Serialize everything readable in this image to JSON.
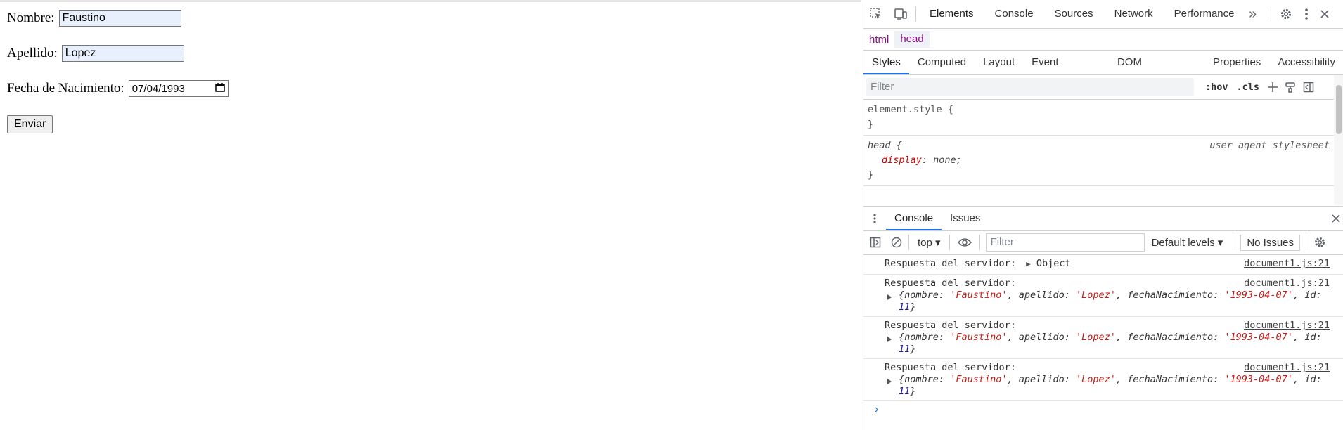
{
  "form": {
    "nombre_label": "Nombre:",
    "nombre_value": "Faustino",
    "apellido_label": "Apellido:",
    "apellido_value": "Lopez",
    "fecha_label": "Fecha de Nacimiento:",
    "fecha_value": "07/04/1993",
    "submit_label": "Enviar"
  },
  "devtools": {
    "top_tabs": [
      "Elements",
      "Console",
      "Sources",
      "Network",
      "Performance"
    ],
    "more_tabs": "»",
    "breadcrumbs": [
      "html",
      "head"
    ],
    "styles_tabs": [
      "Styles",
      "Computed",
      "Layout",
      "Event Listeners",
      "DOM Breakpoints",
      "Properties",
      "Accessibility"
    ],
    "styles_filter_placeholder": "Filter",
    "hov": ":hov",
    "cls": ".cls",
    "element_style": "element.style {",
    "close_brace": "}",
    "head_selector": "head {",
    "ua_source": "user agent stylesheet",
    "prop_name": "display",
    "prop_value": "none;",
    "drawer_tabs": [
      "Console",
      "Issues"
    ],
    "context": "top",
    "console_filter_placeholder": "Filter",
    "levels": "Default levels",
    "no_issues": "No Issues",
    "logs": [
      {
        "message": "Respuesta del servidor:",
        "source": "document1.js:21",
        "summary": "Object"
      },
      {
        "message": "Respuesta del servidor:",
        "source": "document1.js:21",
        "nombre": "'Faustino'",
        "apellido": "'Lopez'",
        "fecha": "'1993-04-07'",
        "id": "11"
      },
      {
        "message": "Respuesta del servidor:",
        "source": "document1.js:21",
        "nombre": "'Faustino'",
        "apellido": "'Lopez'",
        "fecha": "'1993-04-07'",
        "id": "11"
      },
      {
        "message": "Respuesta del servidor:",
        "source": "document1.js:21",
        "nombre": "'Faustino'",
        "apellido": "'Lopez'",
        "fecha": "'1993-04-07'",
        "id": "11"
      }
    ],
    "obj_keys": {
      "nombre": "nombre:",
      "apellido": "apellido:",
      "fecha": "fechaNacimiento:",
      "id": "id:"
    },
    "prompt": "›"
  },
  "colors": {
    "accent": "#1a73e8",
    "string": "#c41a16",
    "number": "#1a1aa6",
    "tag": "#881280"
  }
}
